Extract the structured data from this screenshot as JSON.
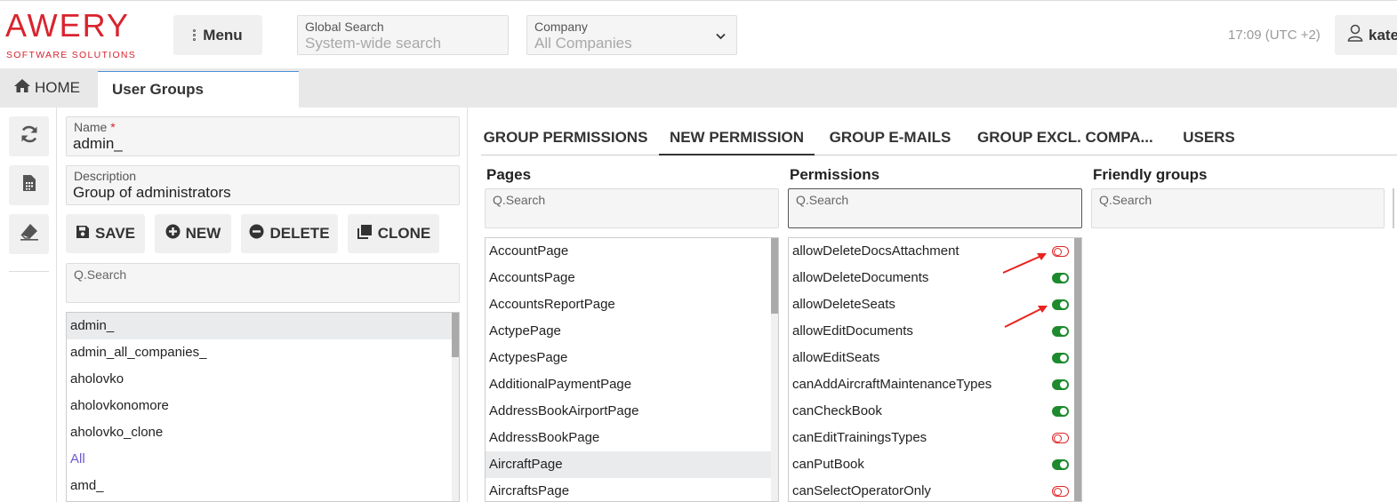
{
  "header": {
    "logo_main": "AWERY",
    "logo_sub": "SOFTWARE SOLUTIONS",
    "menu_label": "Menu",
    "global_search": {
      "label": "Global Search",
      "placeholder": "System-wide search"
    },
    "company": {
      "label": "Company",
      "value": "All Companies"
    },
    "clock": "17:09 (UTC +2)",
    "user": "kate"
  },
  "tabs": {
    "home": "HOME",
    "active": "User Groups"
  },
  "side_icons": [
    "refresh-icon",
    "report-icon",
    "eraser-icon"
  ],
  "form": {
    "name": {
      "label": "Name",
      "required_mark": "*",
      "value": "admin_"
    },
    "description": {
      "label": "Description",
      "value": "Group of administrators"
    },
    "buttons": {
      "save": "SAVE",
      "new": "NEW",
      "delete": "DELETE",
      "clone": "CLONE"
    },
    "search_placeholder": "Q.Search",
    "groups": [
      "admin_",
      "admin_all_companies_",
      "aholovko",
      "aholovkonomore",
      "aholovko_clone",
      "All",
      "amd_"
    ]
  },
  "right": {
    "tabs": [
      "GROUP PERMISSIONS",
      "NEW PERMISSION",
      "GROUP E-MAILS",
      "GROUP EXCL. COMPA...",
      "USERS"
    ],
    "active_tab": "NEW PERMISSION",
    "columns": {
      "pages": "Pages",
      "permissions": "Permissions",
      "friendly": "Friendly groups"
    },
    "search_placeholder": "Q.Search",
    "pages": [
      "AccountPage",
      "AccountsPage",
      "AccountsReportPage",
      "ActypePage",
      "ActypesPage",
      "AdditionalPaymentPage",
      "AddressBookAirportPage",
      "AddressBookPage",
      "AircraftPage",
      "AircraftsPage"
    ],
    "selected_page": "AircraftPage",
    "permissions": [
      {
        "name": "allowDeleteDocsAttachment",
        "enabled": false
      },
      {
        "name": "allowDeleteDocuments",
        "enabled": true
      },
      {
        "name": "allowDeleteSeats",
        "enabled": true
      },
      {
        "name": "allowEditDocuments",
        "enabled": true
      },
      {
        "name": "allowEditSeats",
        "enabled": true
      },
      {
        "name": "canAddAircraftMaintenanceTypes",
        "enabled": true
      },
      {
        "name": "canCheckBook",
        "enabled": true
      },
      {
        "name": "canEditTrainingsTypes",
        "enabled": false
      },
      {
        "name": "canPutBook",
        "enabled": true
      },
      {
        "name": "canSelectOperatorOnly",
        "enabled": false
      }
    ]
  },
  "colors": {
    "brand": "#d9232e",
    "toggle_on": "#1e8a2e",
    "toggle_off": "#e02424",
    "link": "#6a5acd"
  }
}
